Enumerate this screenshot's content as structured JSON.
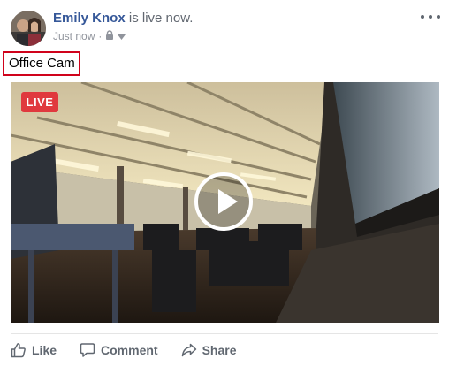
{
  "post": {
    "author_name": "Emily Knox",
    "status_text": " is live now.",
    "timestamp": "Just now",
    "separator": "·",
    "text": "Office Cam"
  },
  "icons": {
    "audience": "lock-icon",
    "audience_menu": "chevron-down-icon",
    "more": "more-options-icon",
    "like": "thumbs-up-icon",
    "comment": "speech-bubble-icon",
    "share": "share-arrow-icon",
    "play": "play-icon"
  },
  "video": {
    "live_label": "LIVE"
  },
  "actions": {
    "like_label": "Like",
    "comment_label": "Comment",
    "share_label": "Share"
  },
  "colors": {
    "author": "#365899",
    "live_badge": "#e0393e",
    "highlight_border": "#d0021b",
    "action_text": "#606770"
  }
}
